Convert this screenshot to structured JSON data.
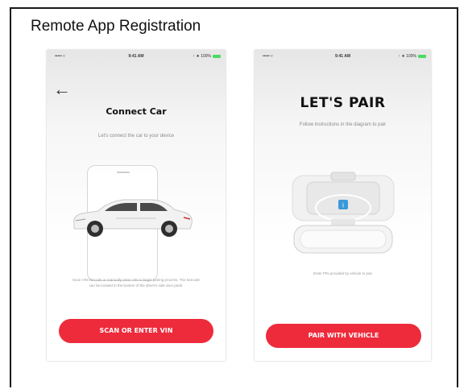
{
  "page": {
    "heading": "Remote App Registration"
  },
  "left_screen": {
    "status": {
      "signal": "••••• ▿",
      "time": "9:41 AM",
      "battery": "↑ ★ 100%"
    },
    "back_icon": "arrow-left",
    "title": "Connect Car",
    "subtitle": "Let's connect the car to your device",
    "caption": "Scan VIN barcode or manually enter VIN to begin pairing process. The barcode can be located in the bottom of the driver's side door jamb.",
    "cta_label": "SCAN OR ENTER VIN"
  },
  "right_screen": {
    "status": {
      "signal": "••••• ▿",
      "time": "9:41 AM",
      "battery": "↑ ★ 100%"
    },
    "title": "LET'S PAIR",
    "subtitle": "Follow instructions in the diagram to pair",
    "caption": "Enter PIN provided by vehicle to pair",
    "cta_label": "PAIR WITH VEHICLE"
  },
  "colors": {
    "accent": "#ee2b3b",
    "status_battery": "#4cd964",
    "info_button": "#3a9ad9"
  }
}
